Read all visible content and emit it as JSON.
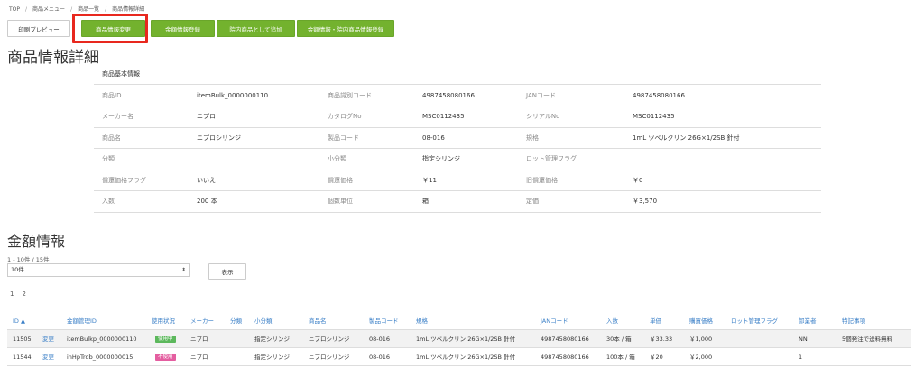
{
  "breadcrumb": [
    "TOP",
    "商品メニュー",
    "商品一覧",
    "商品情報詳細"
  ],
  "actions": {
    "print_preview": "印刷プレビュー",
    "change": "商品情報変更",
    "price_register": "金額情報登録",
    "add_internal": "院内商品として追加",
    "price_internal_register": "金額情報・院内商品情報登録"
  },
  "page_title": "商品情報詳細",
  "detail": {
    "subhead": "商品基本情報",
    "rows": [
      [
        {
          "label": "商品ID",
          "value": "itemBulk_0000000110"
        },
        {
          "label": "商品識別コード",
          "value": "4987458080166"
        },
        {
          "label": "JANコード",
          "value": "4987458080166"
        }
      ],
      [
        {
          "label": "メーカー名",
          "value": "ニプロ"
        },
        {
          "label": "カタログNo",
          "value": "MSC0112435"
        },
        {
          "label": "シリアルNo",
          "value": "MSC0112435"
        }
      ],
      [
        {
          "label": "商品名",
          "value": "ニプロシリンジ"
        },
        {
          "label": "製品コード",
          "value": "08-016"
        },
        {
          "label": "規格",
          "value": "1mL ツベルクリン 26G×1/2SB 針付"
        }
      ],
      [
        {
          "label": "分類",
          "value": ""
        },
        {
          "label": "小分類",
          "value": "指定シリンジ"
        },
        {
          "label": "ロット管理フラグ",
          "value": ""
        }
      ],
      [
        {
          "label": "償還価格フラグ",
          "value": "いいえ"
        },
        {
          "label": "償還価格",
          "value": "￥11"
        },
        {
          "label": "旧償還価格",
          "value": "￥0"
        }
      ],
      [
        {
          "label": "入数",
          "value": "200 本"
        },
        {
          "label": "個数単位",
          "value": "箱"
        },
        {
          "label": "定価",
          "value": "￥3,570"
        }
      ]
    ]
  },
  "price_section": {
    "title": "金額情報",
    "count": "1 - 10件 / 15件",
    "per_page": "10件",
    "show_button": "表示",
    "pages": [
      "1",
      "2"
    ],
    "columns": {
      "id": "ID ▲",
      "mgmt_id": "金額管理ID",
      "status": "使用状況",
      "maker": "メーカー",
      "category": "分類",
      "subcategory": "小分類",
      "name": "商品名",
      "product_code": "製品コード",
      "spec": "規格",
      "jan": "JANコード",
      "qty": "入数",
      "unit_price": "単価",
      "purchase_price": "購買価格",
      "lot_flag": "ロット管理フラグ",
      "wholesaler": "卸業者",
      "notes": "特記事項"
    },
    "rows": [
      {
        "id": "11505",
        "edit": "変更",
        "mgmt_id": "itemBulkp_0000000110",
        "status": "使用中",
        "status_type": "active",
        "maker": "ニプロ",
        "category": "",
        "subcategory": "指定シリンジ",
        "name": "ニプロシリンジ",
        "product_code": "08-016",
        "spec": "1mL ツベルクリン 26G×1/2SB 針付",
        "jan": "4987458080166",
        "qty": "30本 / 箱",
        "unit_price": "￥33.33",
        "purchase_price": "￥1,000",
        "lot_flag": "",
        "wholesaler": "NN",
        "notes": "5個発注で送料無料"
      },
      {
        "id": "11544",
        "edit": "変更",
        "mgmt_id": "inHpTrdb_0000000015",
        "status": "不使用",
        "status_type": "inactive",
        "maker": "ニプロ",
        "category": "",
        "subcategory": "指定シリンジ",
        "name": "ニプロシリンジ",
        "product_code": "08-016",
        "spec": "1mL ツベルクリン 26G×1/2SB 針付",
        "jan": "4987458080166",
        "qty": "100本 / 箱",
        "unit_price": "￥20",
        "purchase_price": "￥2,000",
        "lot_flag": "",
        "wholesaler": "1",
        "notes": ""
      }
    ]
  }
}
